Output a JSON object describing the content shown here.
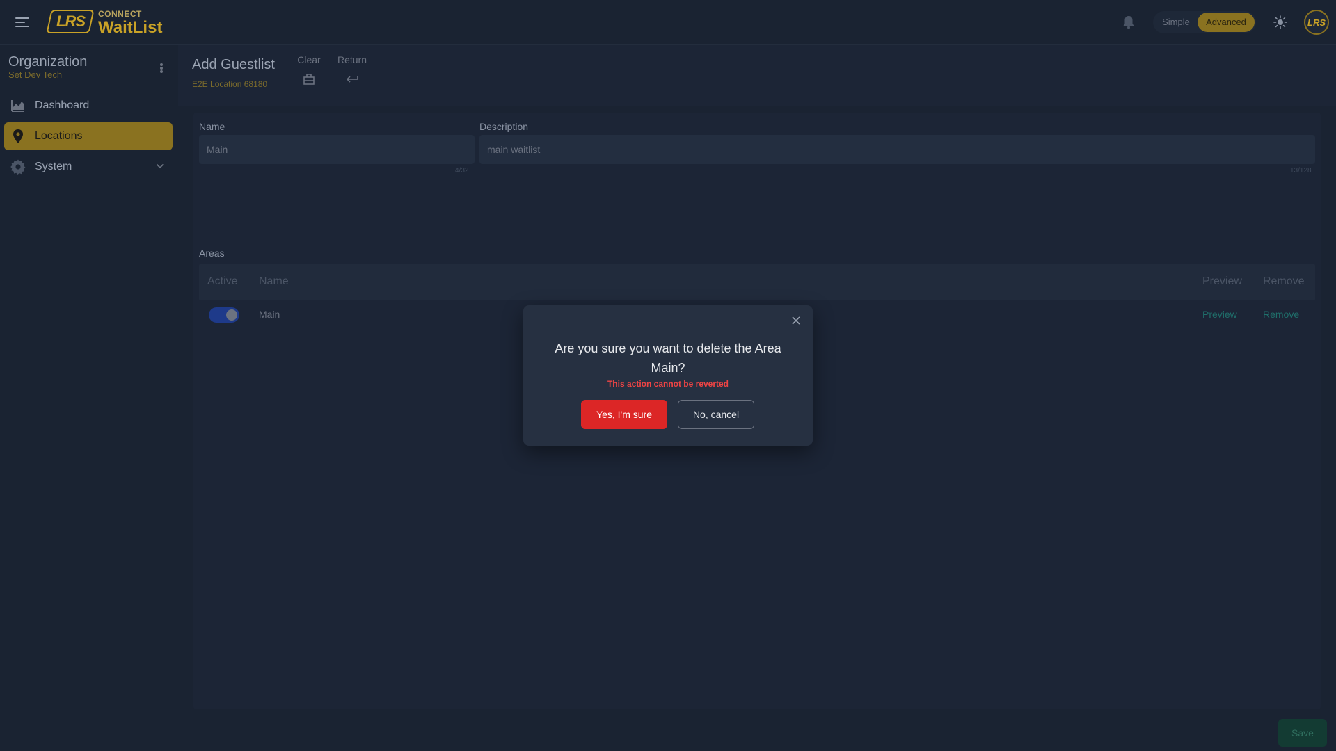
{
  "brand": {
    "logo_text": "LRS",
    "subtitle": "CONNECT",
    "title": "WaitList"
  },
  "header": {
    "mode": {
      "simple_label": "Simple",
      "advanced_label": "Advanced",
      "selected": "Advanced"
    },
    "avatar_text": "LRS"
  },
  "sidebar": {
    "org_title": "Organization",
    "org_subtitle": "Set Dev Tech",
    "items": [
      {
        "label": "Dashboard",
        "icon": "chart-icon",
        "active": false
      },
      {
        "label": "Locations",
        "icon": "map-pin-icon",
        "active": true
      },
      {
        "label": "System",
        "icon": "gear-icon",
        "active": false,
        "expandable": true
      }
    ]
  },
  "page": {
    "title": "Add Guestlist",
    "subtitle": "E2E Location 68180",
    "actions": [
      {
        "label": "Clear",
        "icon": "eraser-icon"
      },
      {
        "label": "Return",
        "icon": "return-icon"
      }
    ]
  },
  "form": {
    "name": {
      "label": "Name",
      "value": "Main",
      "counter": "4/32"
    },
    "description": {
      "label": "Description",
      "value": "main waitlist",
      "counter": "13/128"
    },
    "areas_label": "Areas"
  },
  "table": {
    "columns": {
      "active": "Active",
      "name": "Name",
      "preview": "Preview",
      "remove": "Remove"
    },
    "rows": [
      {
        "active": true,
        "name": "Main",
        "preview": "Preview",
        "remove": "Remove"
      }
    ]
  },
  "save_label": "Save",
  "dialog": {
    "title": "Are you sure you want to delete the Area Main?",
    "warning": "This action cannot be reverted",
    "confirm_label": "Yes, I'm sure",
    "cancel_label": "No, cancel"
  },
  "colors": {
    "accent_gold": "#c9a227",
    "active_nav": "#8a7220",
    "danger": "#dc2626",
    "link_teal": "#1f6f6b"
  }
}
